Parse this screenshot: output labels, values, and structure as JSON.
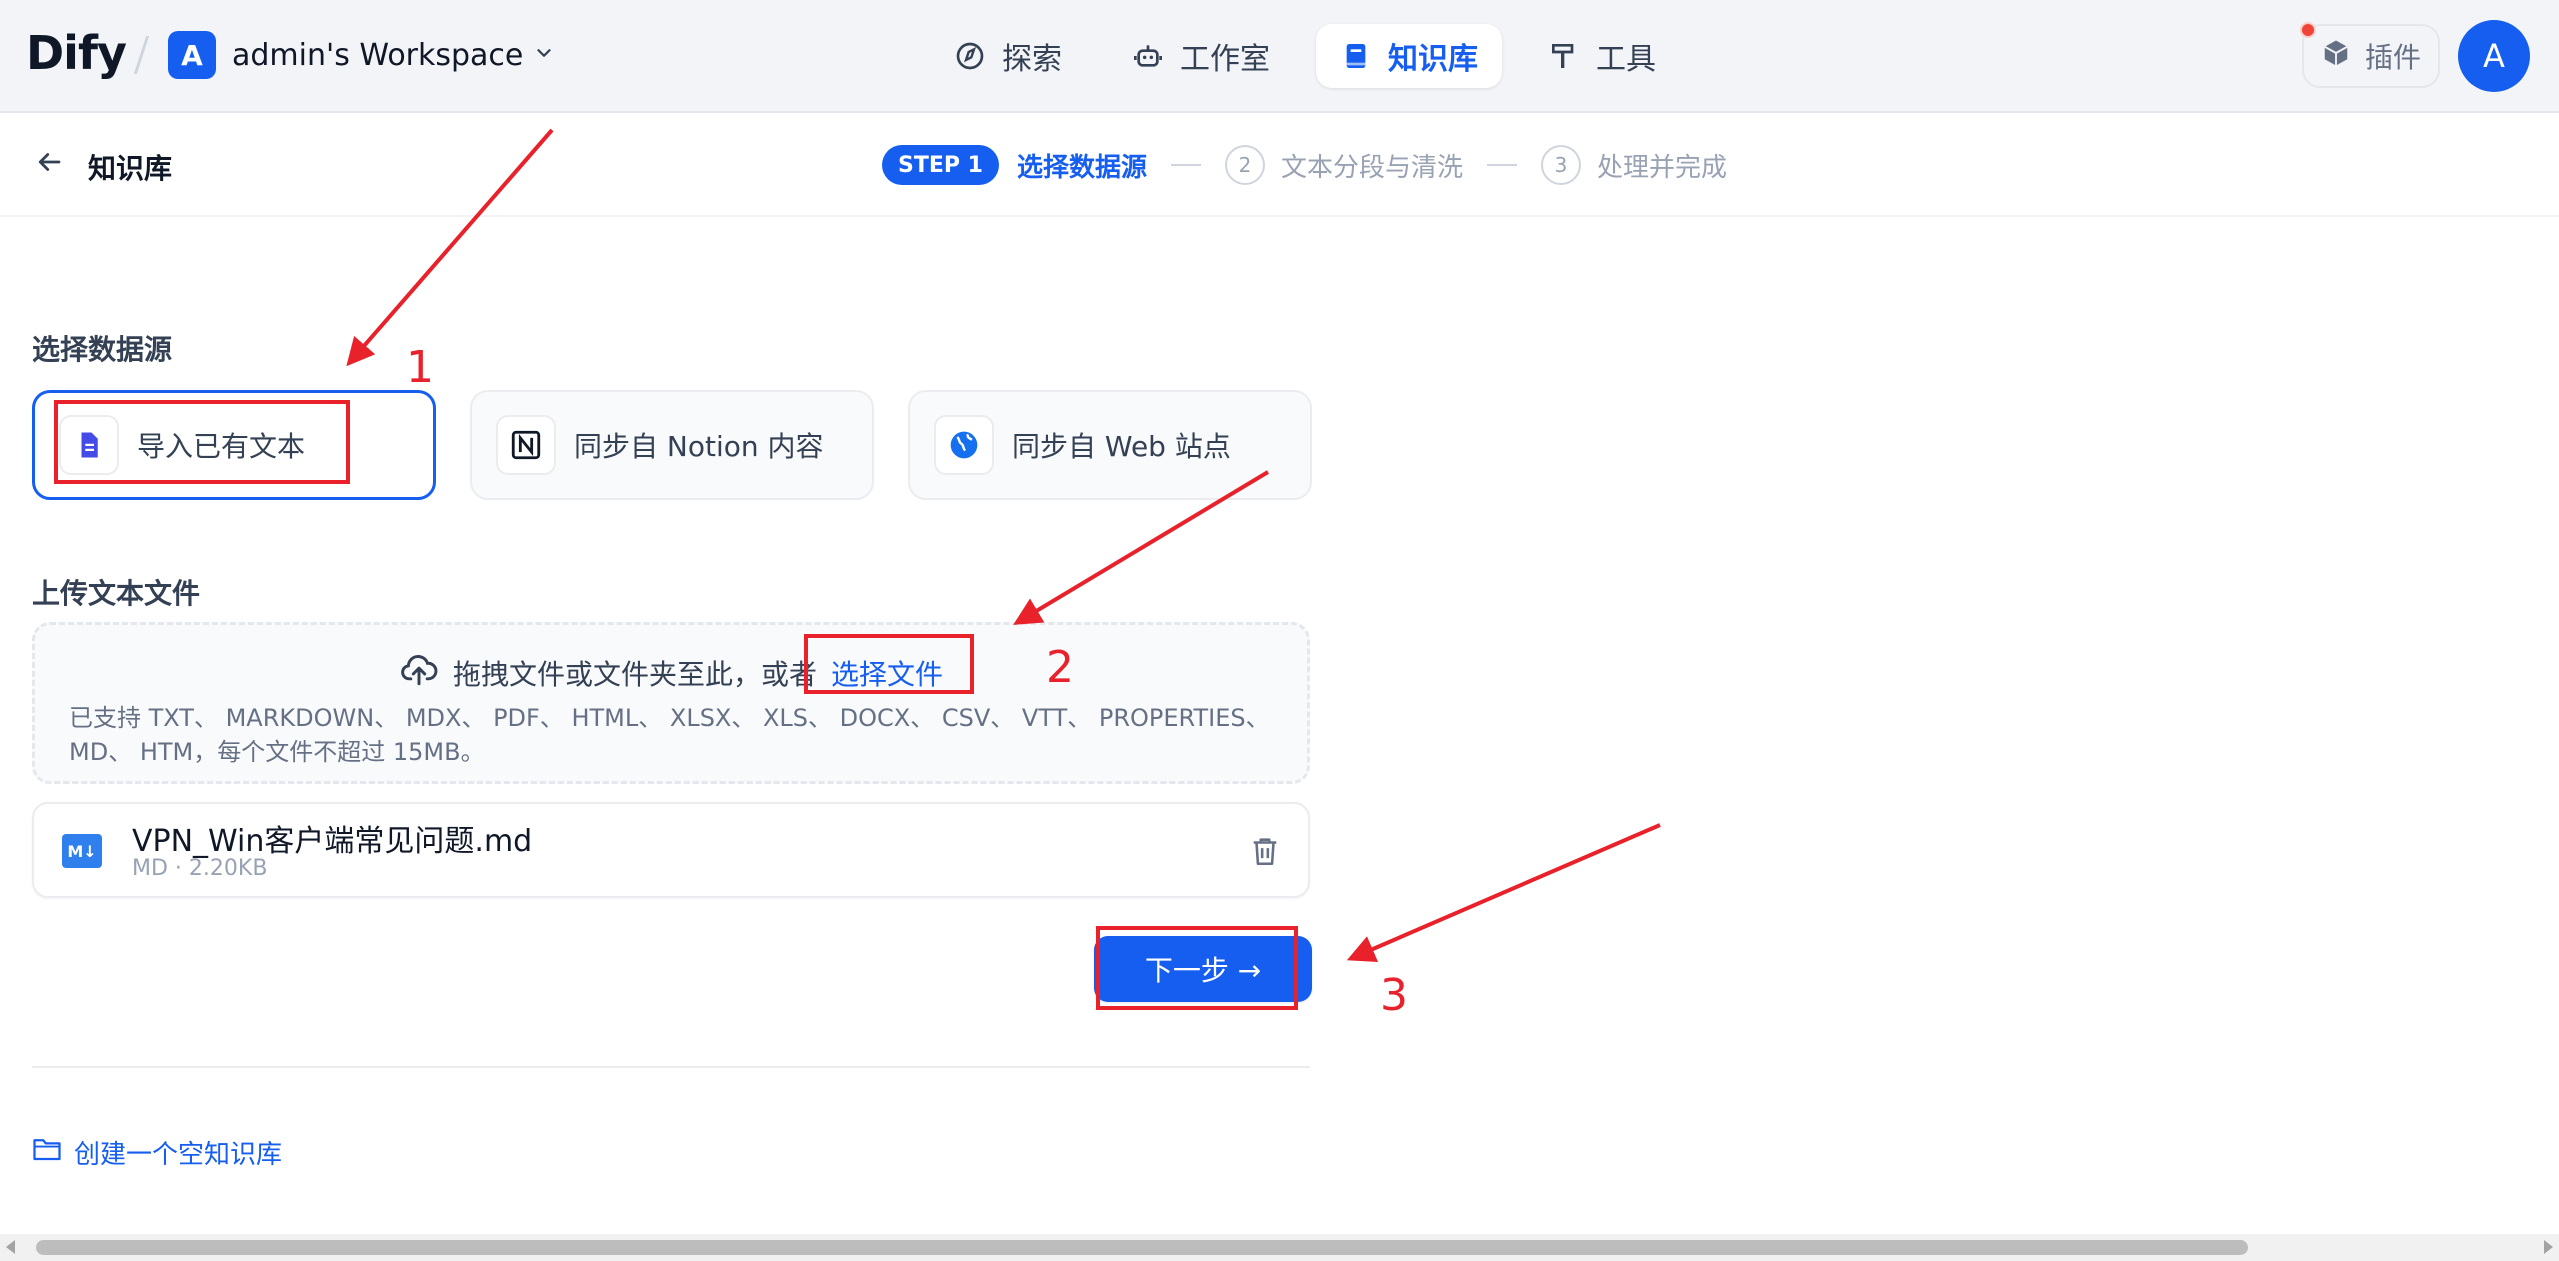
{
  "header": {
    "logo": "Dify",
    "workspace": {
      "avatar": "A",
      "name": "admin's Workspace"
    },
    "nav": [
      {
        "label": "探索",
        "icon": "compass-icon",
        "active": false
      },
      {
        "label": "工作室",
        "icon": "robot-icon",
        "active": false
      },
      {
        "label": "知识库",
        "icon": "book-icon",
        "active": true
      },
      {
        "label": "工具",
        "icon": "hammer-icon",
        "active": false
      }
    ],
    "plugins_label": "插件",
    "user_avatar": "A"
  },
  "subheader": {
    "back_label": "知识库",
    "steps": {
      "step1_badge": "STEP 1",
      "step1_label": "选择数据源",
      "step2_num": "2",
      "step2_label": "文本分段与清洗",
      "step3_num": "3",
      "step3_label": "处理并完成"
    }
  },
  "main": {
    "datasource_title": "选择数据源",
    "sources": [
      {
        "label": "导入已有文本",
        "icon": "file-text-icon",
        "selected": true
      },
      {
        "label": "同步自 Notion 内容",
        "icon": "notion-icon",
        "selected": false
      },
      {
        "label": "同步自 Web 站点",
        "icon": "globe-icon",
        "selected": false
      }
    ],
    "upload_title": "上传文本文件",
    "dropzone": {
      "text": "拖拽文件或文件夹至此，或者",
      "link": "选择文件",
      "hint": "已支持 TXT、 MARKDOWN、 MDX、 PDF、 HTML、 XLSX、 XLS、 DOCX、 CSV、 VTT、 PROPERTIES、 MD、 HTM，每个文件不超过 15MB。"
    },
    "file": {
      "badge": "M↓",
      "name": "VPN_Win客户端常见问题.md",
      "meta": "MD · 2.20KB"
    },
    "next_label": "下一步 →",
    "create_empty_label": "创建一个空知识库"
  },
  "annotations": {
    "num1": "1",
    "num2": "2",
    "num3": "3",
    "color": "#e8212b"
  },
  "colors": {
    "primary": "#155eef",
    "header_bg": "#f2f4f7"
  }
}
